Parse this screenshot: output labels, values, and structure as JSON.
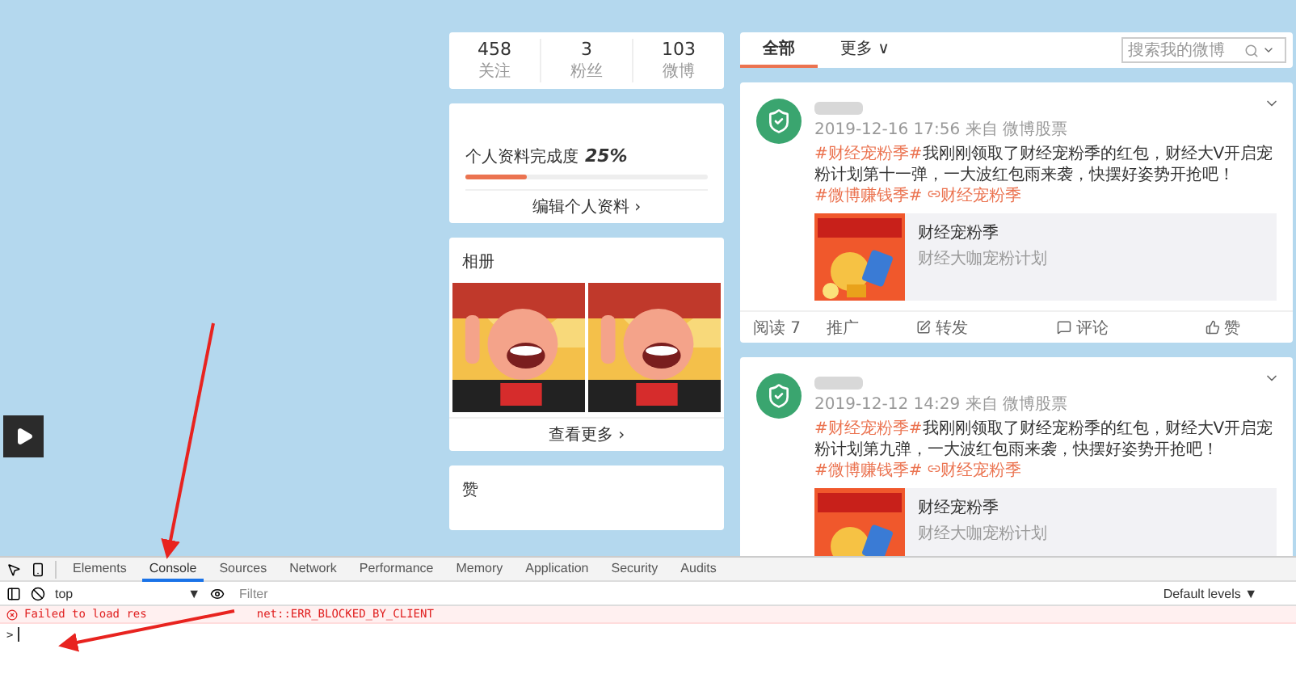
{
  "profile_stats": [
    {
      "value": "458",
      "label": "关注"
    },
    {
      "value": "3",
      "label": "粉丝"
    },
    {
      "value": "103",
      "label": "微博"
    }
  ],
  "profile_completion": {
    "label": "个人资料完成度",
    "reading": "25%",
    "level": 0.25,
    "link": "编辑个人资料 ›"
  },
  "album": {
    "title": "相册",
    "more": "查看更多 ›"
  },
  "likes_card": {
    "title": "赞"
  },
  "feed_tabs": [
    {
      "label": "全部",
      "selected": true
    },
    {
      "label": "更多 ∨",
      "selected": false
    }
  ],
  "feed_search": {
    "placeholder": "搜索我的微博"
  },
  "posts": [
    {
      "time_source": "2019-12-16 17:56 来自 微博股票",
      "topic": "#财经宠粉季#",
      "body": "我刚刚领取了财经宠粉季的红包，财经大V开启宠粉计划第十一弹，一大波红包雨来袭，快摆好姿势开抢吧！",
      "tags": [
        "#微博赚钱季#",
        "财经宠粉季"
      ],
      "card": {
        "title": "财经宠粉季",
        "subtitle": "财经大咖宠粉计划"
      },
      "actions": [
        {
          "label": "阅读 7",
          "kind": "text"
        },
        {
          "label": "推广",
          "kind": "text"
        },
        {
          "label": "转发",
          "kind": "share"
        },
        {
          "label": "评论",
          "kind": "comment"
        },
        {
          "label": "赞",
          "kind": "like"
        }
      ]
    },
    {
      "time_source": "2019-12-12 14:29 来自 微博股票",
      "topic": "#财经宠粉季#",
      "body": "我刚刚领取了财经宠粉季的红包，财经大V开启宠粉计划第九弹，一大波红包雨来袭，快摆好姿势开抢吧！",
      "tags": [
        "#微博赚钱季#",
        "财经宠粉季"
      ],
      "card": {
        "title": "财经宠粉季",
        "subtitle": "财经大咖宠粉计划"
      }
    }
  ],
  "devtools": {
    "tabs": [
      {
        "label": "Elements",
        "selected": false
      },
      {
        "label": "Console",
        "selected": true
      },
      {
        "label": "Sources",
        "selected": false
      },
      {
        "label": "Network",
        "selected": false
      },
      {
        "label": "Performance",
        "selected": false
      },
      {
        "label": "Memory",
        "selected": false
      },
      {
        "label": "Application",
        "selected": false
      },
      {
        "label": "Security",
        "selected": false
      },
      {
        "label": "Audits",
        "selected": false
      }
    ],
    "context": "top",
    "context_caret": "▼",
    "filter_placeholder": "Filter",
    "levels": "Default levels ▼",
    "messages": [
      {
        "kind": "error",
        "parts": [
          "Failed to load res",
          "net::ERR_BLOCKED_BY_CLIENT"
        ]
      }
    ],
    "prompt": ">"
  }
}
